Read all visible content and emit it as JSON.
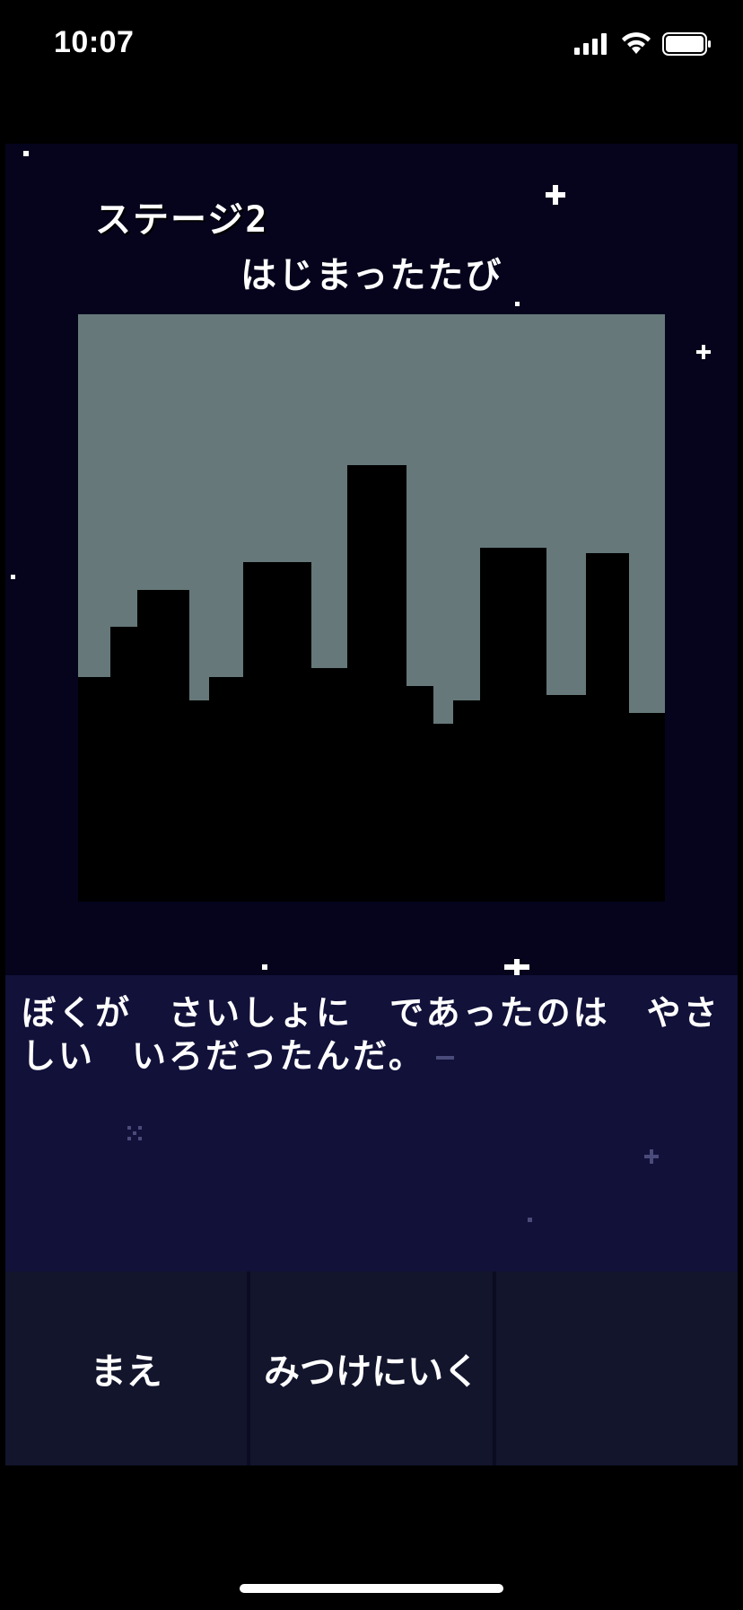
{
  "status_bar": {
    "time": "10:07",
    "icons": [
      "cellular-signal-icon",
      "wifi-icon",
      "battery-icon"
    ]
  },
  "stage": {
    "label": "ステージ2",
    "title": "はじまったたび",
    "scene": {
      "sky_color": "#667879",
      "building_color": "#000000"
    }
  },
  "dialog": {
    "text": "ぼくが　さいしょに　であったのは　やさしい　いろだったんだ。"
  },
  "buttons": {
    "back_label": "まえ",
    "go_find_label": "みつけにいく",
    "third_label": ""
  },
  "colors": {
    "background": "#000000",
    "stage_bg": "#05041c",
    "dialog_bg": "#11113a",
    "button_bg": "#13152d"
  }
}
